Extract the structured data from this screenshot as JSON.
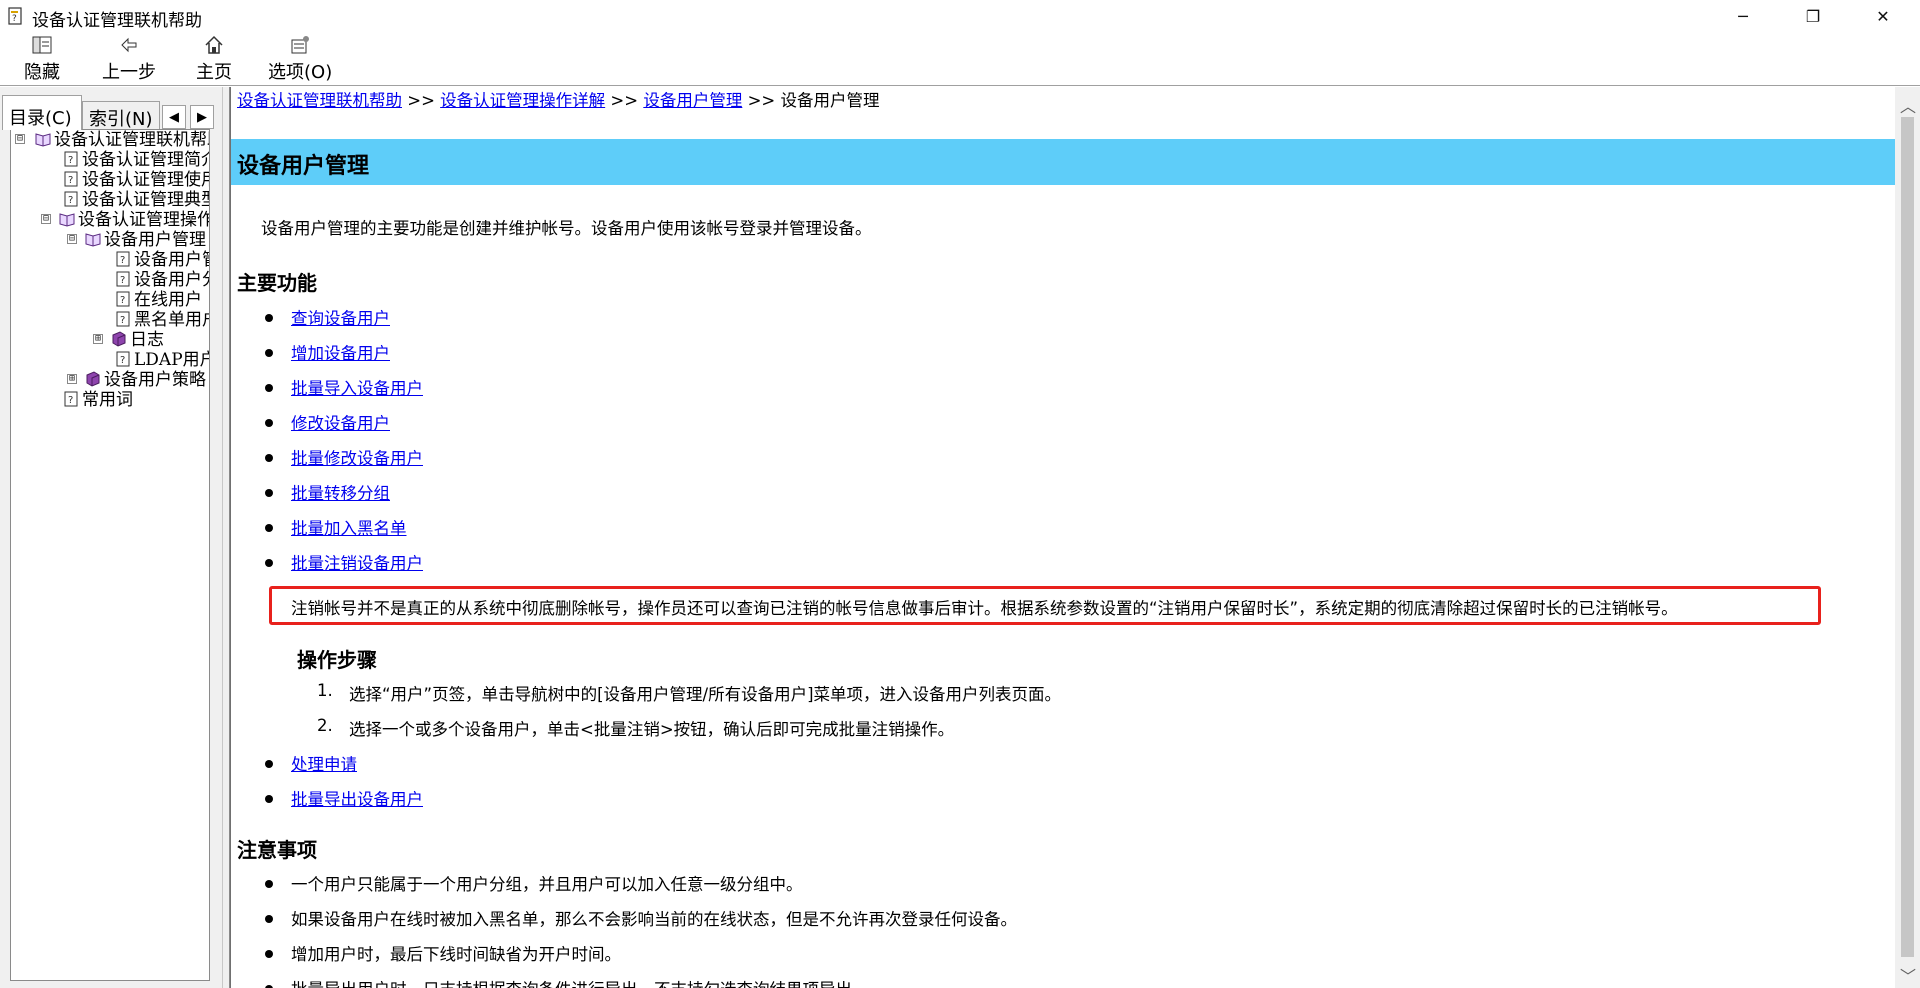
{
  "window": {
    "title": "设备认证管理联机帮助",
    "icon": "help-book-icon",
    "controls": {
      "minimize": "─",
      "restore": "❐",
      "close": "✕"
    }
  },
  "toolbar": {
    "hide_label": "隐藏",
    "back_label": "上一步",
    "home_label": "主页",
    "options_label": "选项(O)"
  },
  "navpane": {
    "tabs": [
      "目录(C)",
      "索引(N)"
    ],
    "tab_prev": "◀",
    "tab_next": "▶",
    "tree": [
      {
        "label": "设备认证管理联机帮助",
        "icon": "open-book-icon",
        "expander": "⊟"
      },
      {
        "label": "设备认证管理简介",
        "icon": "help-page-icon"
      },
      {
        "label": "设备认证管理使用说明",
        "icon": "help-page-icon"
      },
      {
        "label": "设备认证管理典型组网",
        "icon": "help-page-icon"
      },
      {
        "label": "设备认证管理操作详解",
        "icon": "open-book-icon",
        "expander": "⊟"
      },
      {
        "label": "设备用户管理",
        "icon": "open-book-icon",
        "expander": "⊟"
      },
      {
        "label": "设备用户管理",
        "icon": "help-page-icon"
      },
      {
        "label": "设备用户分组",
        "icon": "help-page-icon"
      },
      {
        "label": "在线用户",
        "icon": "help-page-icon"
      },
      {
        "label": "黑名单用户",
        "icon": "help-page-icon"
      },
      {
        "label": "日志",
        "icon": "closed-book-icon",
        "expander": "⊞"
      },
      {
        "label": "LDAP用户",
        "icon": "help-page-icon"
      },
      {
        "label": "设备用户策略",
        "icon": "closed-book-icon",
        "expander": "⊞"
      },
      {
        "label": "常用词",
        "icon": "help-page-icon"
      }
    ]
  },
  "content": {
    "breadcrumb": {
      "items": [
        "设备认证管理联机帮助",
        "设备认证管理操作详解",
        "设备用户管理"
      ],
      "separator": ">>",
      "current": "设备用户管理"
    },
    "heading": "设备用户管理",
    "intro": "设备用户管理的主要功能是创建并维护帐号。设备用户使用该帐号登录并管理设备。",
    "main_features_title": "主要功能",
    "feature_links": [
      "查询设备用户",
      "增加设备用户",
      "批量导入设备用户",
      "修改设备用户",
      "批量修改设备用户",
      "批量转移分组",
      "批量加入黑名单",
      "批量注销设备用户"
    ],
    "note": "注销帐号并不是真正的从系统中彻底删除帐号，操作员还可以查询已注销的帐号信息做事后审计。根据系统参数设置的“注销用户保留时长”，系统定期的彻底清除超过保留时长的已注销帐号。",
    "steps_title": "操作步骤",
    "steps": [
      {
        "num": "1.",
        "text": "选择“用户”页签，单击导航树中的[设备用户管理/所有设备用户]菜单项，进入设备用户列表页面。"
      },
      {
        "num": "2.",
        "text": "选择一个或多个设备用户，单击<批量注销>按钮，确认后即可完成批量注销操作。"
      }
    ],
    "more_links": [
      "处理申请",
      "批量导出设备用户"
    ],
    "notes_title": "注意事项",
    "notes": [
      "一个用户只能属于一个用户分组，并且用户可以加入任意一级分组中。",
      "如果设备用户在线时被加入黑名单，那么不会影响当前的在线状态，但是不允许再次登录任何设备。",
      "增加用户时，最后下线时间缺省为开户时间。",
      "批量导出用户时，只支持根据查询条件进行导出，不支持勾选查询结果项导出。"
    ],
    "highlight_color": "#e8211c",
    "banner_color": "#5ecdf9"
  },
  "scrollbar": {
    "up": "︿",
    "down": "﹀"
  }
}
